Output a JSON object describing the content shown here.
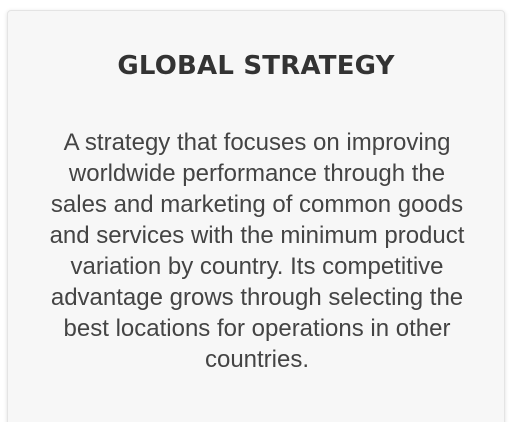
{
  "card": {
    "title": "GLOBAL STRATEGY",
    "description": "A strategy that focuses on improving worldwide performance through the sales and marketing of common goods and services with the minimum product variation by country. Its competitive advantage grows through selecting the best locations for operations in other countries."
  },
  "colors": {
    "card_background": "#f7f7f7",
    "title_text": "#333333",
    "body_text": "#444444"
  }
}
